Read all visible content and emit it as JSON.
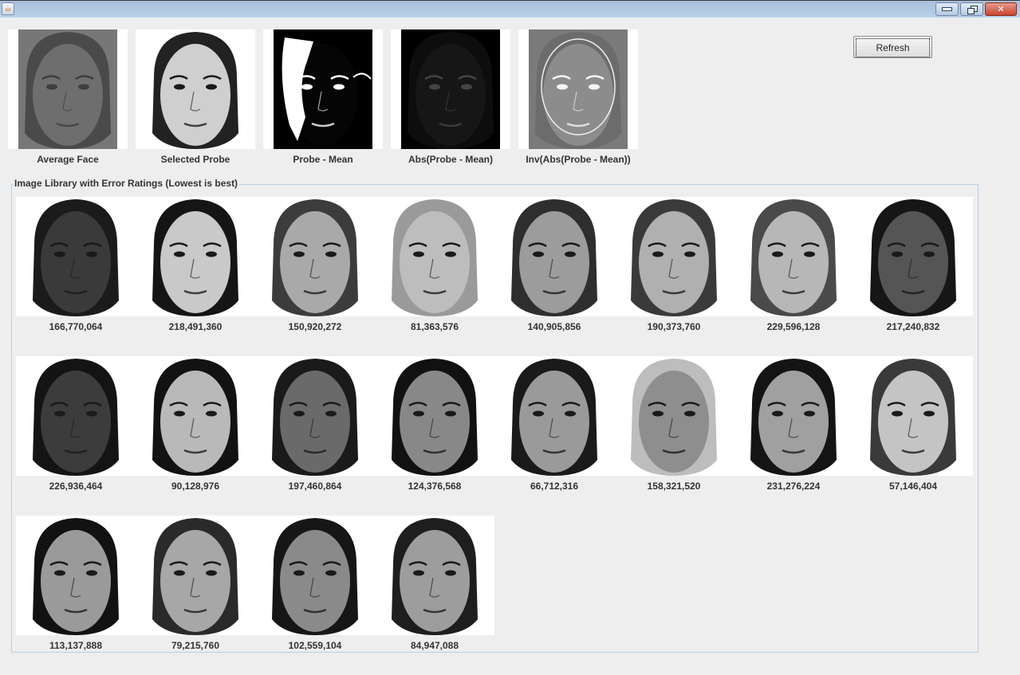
{
  "window": {
    "title": "",
    "app_icon": "java-cup-icon",
    "controls": {
      "minimize": "minimize-icon",
      "restore": "restore-icon",
      "close": "close-icon"
    }
  },
  "toolbar": {
    "refresh_label": "Refresh"
  },
  "previews": [
    {
      "label": "Average Face",
      "kind": "average",
      "tone": "#6a6a6a"
    },
    {
      "label": "Selected Probe",
      "kind": "probe",
      "tone": "#cfcfcf"
    },
    {
      "label": "Probe - Mean",
      "kind": "diff",
      "tone": "#0a0a0a"
    },
    {
      "label": "Abs(Probe - Mean)",
      "kind": "absdiff",
      "tone": "#111111"
    },
    {
      "label": "Inv(Abs(Probe - Mean))",
      "kind": "invabs",
      "tone": "#8a8a8a"
    }
  ],
  "library": {
    "title": "Image Library with Error Ratings (Lowest is best)",
    "items": [
      {
        "error": "166,770,064",
        "tone": "#3a3a3a",
        "hair": "#1b1b1b"
      },
      {
        "error": "218,491,360",
        "tone": "#c9c9c9",
        "hair": "#151515"
      },
      {
        "error": "150,920,272",
        "tone": "#a9a9a9",
        "hair": "#3c3c3c"
      },
      {
        "error": "81,363,576",
        "tone": "#bdbdbd",
        "hair": "#9a9a9a"
      },
      {
        "error": "140,905,856",
        "tone": "#9c9c9c",
        "hair": "#2e2e2e"
      },
      {
        "error": "190,373,760",
        "tone": "#b0b0b0",
        "hair": "#3a3a3a"
      },
      {
        "error": "229,596,128",
        "tone": "#b7b7b7",
        "hair": "#4a4a4a"
      },
      {
        "error": "217,240,832",
        "tone": "#555555",
        "hair": "#161616"
      },
      {
        "error": "226,936,464",
        "tone": "#3c3c3c",
        "hair": "#141414"
      },
      {
        "error": "90,128,976",
        "tone": "#b9b9b9",
        "hair": "#121212"
      },
      {
        "error": "197,460,864",
        "tone": "#6a6a6a",
        "hair": "#1a1a1a"
      },
      {
        "error": "124,376,568",
        "tone": "#888888",
        "hair": "#111111"
      },
      {
        "error": "66,712,316",
        "tone": "#9a9a9a",
        "hair": "#1a1a1a"
      },
      {
        "error": "158,321,520",
        "tone": "#8e8e8e",
        "hair": "#bdbdbd"
      },
      {
        "error": "231,276,224",
        "tone": "#a0a0a0",
        "hair": "#141414"
      },
      {
        "error": "57,146,404",
        "tone": "#c4c4c4",
        "hair": "#3a3a3a"
      },
      {
        "error": "113,137,888",
        "tone": "#9a9a9a",
        "hair": "#121212"
      },
      {
        "error": "79,215,760",
        "tone": "#a7a7a7",
        "hair": "#2a2a2a"
      },
      {
        "error": "102,559,104",
        "tone": "#8a8a8a",
        "hair": "#161616"
      },
      {
        "error": "84,947,088",
        "tone": "#9d9d9d",
        "hair": "#1e1e1e"
      }
    ]
  }
}
